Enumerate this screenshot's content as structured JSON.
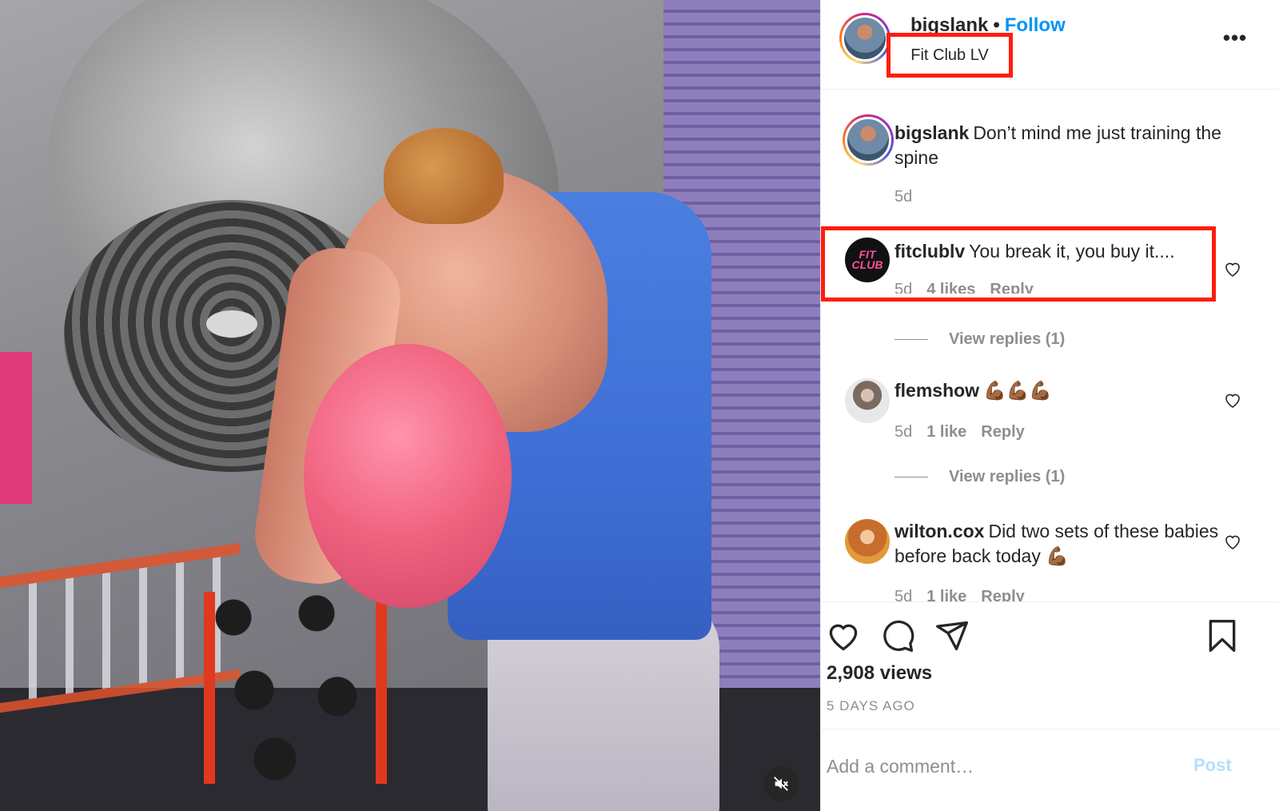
{
  "post": {
    "author": "bigslank",
    "separator": "•",
    "follow_label": "Follow",
    "location": "Fit Club LV",
    "more_label": "•••",
    "views": "2,908 views",
    "posted_ago": "5 DAYS AGO"
  },
  "comments": [
    {
      "username": "bigslank",
      "text": "Don’t mind me just training the spine",
      "time": "5d"
    },
    {
      "username": "fitclublv",
      "text": "You break it, you buy it....",
      "time": "5d",
      "likes": "4 likes",
      "reply_label": "Reply",
      "view_replies": "View replies (1)",
      "avatar_text": "FIT CLUB"
    },
    {
      "username": "flemshow",
      "text": "💪🏾💪🏾💪🏾",
      "time": "5d",
      "likes": "1 like",
      "reply_label": "Reply",
      "view_replies": "View replies (1)"
    },
    {
      "username": "wilton.cox",
      "text": "Did two sets of these babies before back today 💪🏾",
      "time": "5d",
      "likes": "1 like",
      "reply_label": "Reply"
    }
  ],
  "add_comment": {
    "placeholder": "Add a comment…",
    "post_label": "Post"
  },
  "colors": {
    "accent": "#0095f6",
    "annotation": "#ff1d0e",
    "muted": "#8e8e8e",
    "post_disabled": "#b2dffc"
  },
  "icons": [
    "mute-icon",
    "more-icon",
    "heart-icon",
    "comment-icon",
    "share-icon",
    "bookmark-icon"
  ]
}
